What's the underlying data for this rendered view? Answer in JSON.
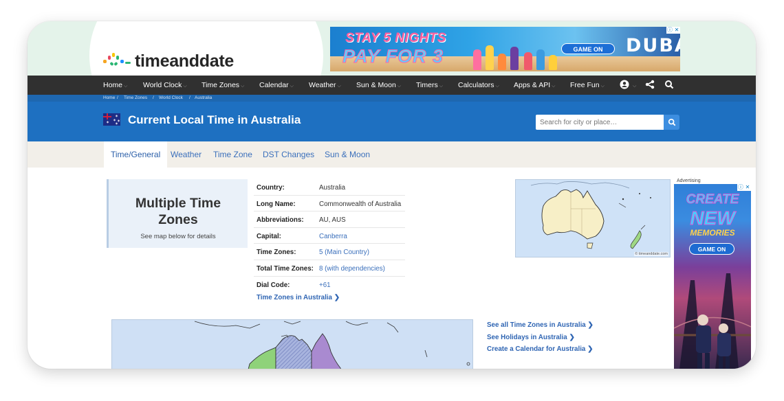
{
  "site": {
    "logo_text": "timeanddate"
  },
  "top_ad": {
    "line1": "STAY 5 NIGHTS",
    "line2": "PAY FOR 3",
    "button": "GAME ON",
    "brand": "DUBAI"
  },
  "nav": {
    "items": [
      {
        "label": "Home"
      },
      {
        "label": "World Clock"
      },
      {
        "label": "Time Zones"
      },
      {
        "label": "Calendar"
      },
      {
        "label": "Weather"
      },
      {
        "label": "Sun & Moon"
      },
      {
        "label": "Timers"
      },
      {
        "label": "Calculators"
      },
      {
        "label": "Apps & API"
      },
      {
        "label": "Free Fun"
      }
    ],
    "icons": [
      "account-icon",
      "share-icon",
      "search-icon"
    ]
  },
  "breadcrumb": [
    "Home",
    "Time Zones",
    "World Clock",
    "Australia"
  ],
  "hero": {
    "title": "Current Local Time in Australia",
    "search_placeholder": "Search for city or place…"
  },
  "tabs": [
    {
      "label": "Time/General",
      "active": true
    },
    {
      "label": "Weather"
    },
    {
      "label": "Time Zone"
    },
    {
      "label": "DST Changes"
    },
    {
      "label": "Sun & Moon"
    }
  ],
  "multiple_zones": {
    "heading": "Multiple Time Zones",
    "subtext": "See map below for details"
  },
  "info": [
    {
      "key": "Country:",
      "value": "Australia"
    },
    {
      "key": "Long Name:",
      "value": "Commonwealth of Australia"
    },
    {
      "key": "Abbreviations:",
      "value": "AU, AUS"
    },
    {
      "key": "Capital:",
      "value": "Canberra",
      "link": true
    },
    {
      "key": "Time Zones:",
      "value": "5 (Main Country)",
      "link": true
    },
    {
      "key": "Total Time Zones:",
      "value": "8 (with dependencies)",
      "link": true
    },
    {
      "key": "Dial Code:",
      "value": "+61",
      "link": true
    }
  ],
  "tz_link": "Time Zones in Australia",
  "map_copyright": "© timeanddate.com",
  "advertising_label": "Advertising",
  "side_ad": {
    "l1": "CREATE",
    "l2": "NEW",
    "l3": "MEMORIES",
    "button": "GAME ON"
  },
  "links": [
    "See all Time Zones in Australia",
    "See Holidays in Australia",
    "Create a Calendar for Australia"
  ],
  "colors": {
    "nav": "#303030",
    "hero": "#1e70c1",
    "link": "#3a6fbb",
    "tabs_bg": "#f2efe9"
  }
}
